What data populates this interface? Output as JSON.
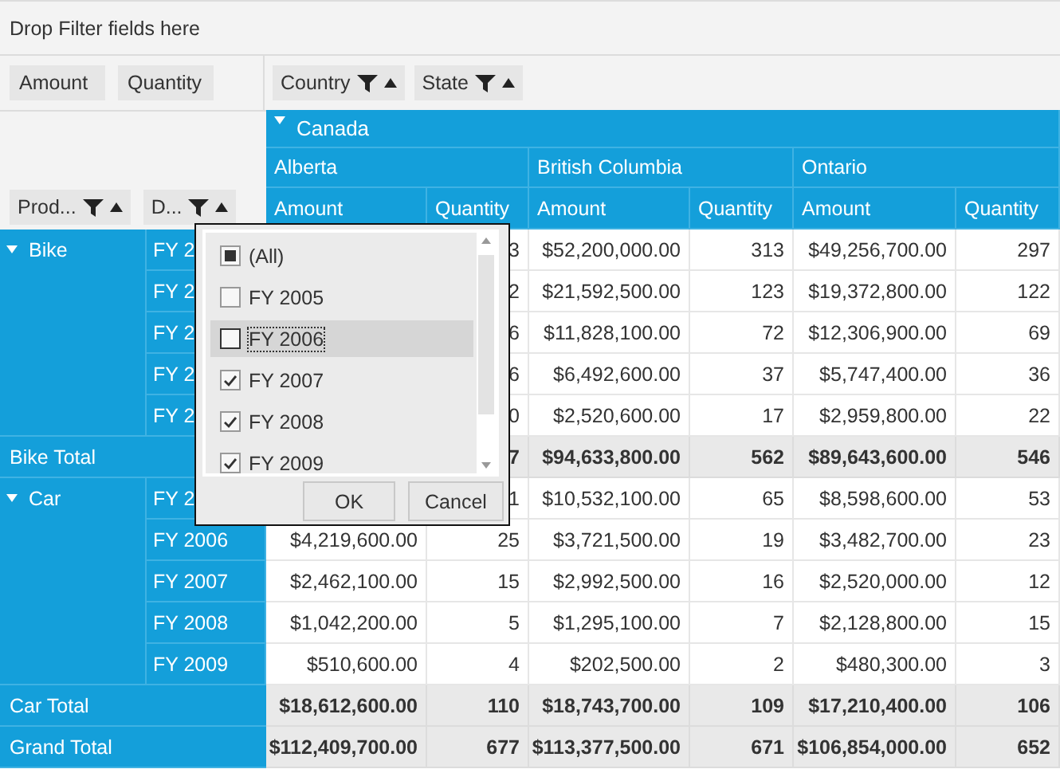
{
  "filter_area": {
    "hint": "Drop Filter fields here"
  },
  "value_fields": [
    "Amount",
    "Quantity"
  ],
  "column_fields": [
    {
      "label": "Country"
    },
    {
      "label": "State"
    }
  ],
  "row_fields": [
    {
      "label": "Prod..."
    },
    {
      "label": "D..."
    }
  ],
  "column_header": {
    "country": "Canada",
    "expanded": true,
    "states": [
      "Alberta",
      "British Columbia",
      "Ontario"
    ],
    "measures": [
      "Amount",
      "Quantity",
      "Amount",
      "Quantity",
      "Amount",
      "Quantity"
    ]
  },
  "row_groups": [
    {
      "label": "Bike",
      "expanded": true,
      "rows": [
        {
          "label": "FY 2",
          "cells": {
            "alberta_quantity": "3",
            "bc_amount": "$52,200,000.00",
            "bc_quantity": "313",
            "ontario_amount": "$49,256,700.00",
            "ontario_quantity": "297"
          }
        },
        {
          "label": "FY 2",
          "cells": {
            "alberta_quantity": "2",
            "bc_amount": "$21,592,500.00",
            "bc_quantity": "123",
            "ontario_amount": "$19,372,800.00",
            "ontario_quantity": "122"
          }
        },
        {
          "label": "FY 2",
          "cells": {
            "alberta_quantity": "6",
            "bc_amount": "$11,828,100.00",
            "bc_quantity": "72",
            "ontario_amount": "$12,306,900.00",
            "ontario_quantity": "69"
          }
        },
        {
          "label": "FY 2",
          "cells": {
            "alberta_quantity": "6",
            "bc_amount": "$6,492,600.00",
            "bc_quantity": "37",
            "ontario_amount": "$5,747,400.00",
            "ontario_quantity": "36"
          }
        },
        {
          "label": "FY 2",
          "cells": {
            "alberta_quantity": "0",
            "bc_amount": "$2,520,600.00",
            "bc_quantity": "17",
            "ontario_amount": "$2,959,800.00",
            "ontario_quantity": "22"
          }
        }
      ],
      "total": {
        "label": "Bike Total",
        "cells": {
          "alberta_quantity": "7",
          "bc_amount": "$94,633,800.00",
          "bc_quantity": "562",
          "ontario_amount": "$89,643,600.00",
          "ontario_quantity": "546"
        }
      }
    },
    {
      "label": "Car",
      "expanded": true,
      "rows": [
        {
          "label": "FY 2",
          "cells": {
            "alberta_quantity": "1",
            "bc_amount": "$10,532,100.00",
            "bc_quantity": "65",
            "ontario_amount": "$8,598,600.00",
            "ontario_quantity": "53"
          }
        },
        {
          "label": "FY 2006",
          "cells": {
            "alberta_amount": "$4,219,600.00",
            "alberta_quantity": "25",
            "bc_amount": "$3,721,500.00",
            "bc_quantity": "19",
            "ontario_amount": "$3,482,700.00",
            "ontario_quantity": "23"
          }
        },
        {
          "label": "FY 2007",
          "cells": {
            "alberta_amount": "$2,462,100.00",
            "alberta_quantity": "15",
            "bc_amount": "$2,992,500.00",
            "bc_quantity": "16",
            "ontario_amount": "$2,520,000.00",
            "ontario_quantity": "12"
          }
        },
        {
          "label": "FY 2008",
          "cells": {
            "alberta_amount": "$1,042,200.00",
            "alberta_quantity": "5",
            "bc_amount": "$1,295,100.00",
            "bc_quantity": "7",
            "ontario_amount": "$2,128,800.00",
            "ontario_quantity": "15"
          }
        },
        {
          "label": "FY 2009",
          "cells": {
            "alberta_amount": "$510,600.00",
            "alberta_quantity": "4",
            "bc_amount": "$202,500.00",
            "bc_quantity": "2",
            "ontario_amount": "$480,300.00",
            "ontario_quantity": "3"
          }
        }
      ],
      "total": {
        "label": "Car Total",
        "cells": {
          "alberta_amount": "$18,612,600.00",
          "alberta_quantity": "110",
          "bc_amount": "$18,743,700.00",
          "bc_quantity": "109",
          "ontario_amount": "$17,210,400.00",
          "ontario_quantity": "106"
        }
      }
    }
  ],
  "grand_total": {
    "label": "Grand Total",
    "cells": {
      "alberta_amount": "$112,409,700.00",
      "alberta_quantity": "677",
      "bc_amount": "$113,377,500.00",
      "bc_quantity": "671",
      "ontario_amount": "$106,854,000.00",
      "ontario_quantity": "652"
    }
  },
  "filter_popup": {
    "items": [
      {
        "label": "(All)",
        "checked": false,
        "indeterminate": true,
        "selected": false
      },
      {
        "label": "FY 2005",
        "checked": false,
        "indeterminate": false,
        "selected": false
      },
      {
        "label": "FY 2006",
        "checked": false,
        "indeterminate": false,
        "selected": true
      },
      {
        "label": "FY 2007",
        "checked": true,
        "indeterminate": false,
        "selected": false
      },
      {
        "label": "FY 2008",
        "checked": true,
        "indeterminate": false,
        "selected": false
      },
      {
        "label": "FY 2009",
        "checked": true,
        "indeterminate": false,
        "selected": false
      }
    ],
    "buttons": [
      "OK",
      "Cancel"
    ]
  }
}
